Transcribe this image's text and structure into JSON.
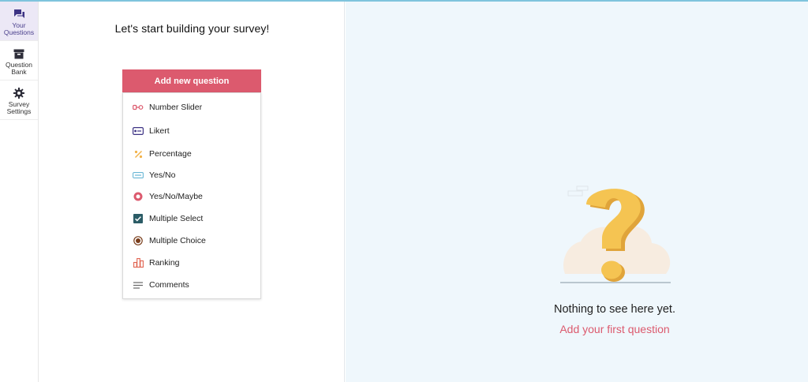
{
  "sidebar": {
    "items": [
      {
        "label": "Your Questions",
        "icon": "chat-bubbles-icon",
        "active": true
      },
      {
        "label": "Question Bank",
        "icon": "archive-box-icon",
        "active": false
      },
      {
        "label": "Survey Settings",
        "icon": "gear-icon",
        "active": false
      }
    ]
  },
  "builder": {
    "title": "Let's start building your survey!",
    "add_button": "Add new question",
    "question_types": [
      {
        "label": "Number Slider",
        "icon": "slider-icon"
      },
      {
        "label": "Likert",
        "icon": "likert-scale-icon"
      },
      {
        "label": "Percentage",
        "icon": "percent-icon"
      },
      {
        "label": "Yes/No",
        "icon": "toggle-bar-icon"
      },
      {
        "label": "Yes/No/Maybe",
        "icon": "radio-ring-icon"
      },
      {
        "label": "Multiple Select",
        "icon": "checkbox-checked-icon"
      },
      {
        "label": "Multiple Choice",
        "icon": "radio-dot-icon"
      },
      {
        "label": "Ranking",
        "icon": "bar-ranking-icon"
      },
      {
        "label": "Comments",
        "icon": "text-lines-icon"
      }
    ]
  },
  "empty_state": {
    "title": "Nothing to see here yet.",
    "link": "Add your first question",
    "illustration": "question-mark-illustration"
  },
  "colors": {
    "accent": "#dc5a6e",
    "active_nav": "#ece8f6",
    "nav_icon": "#4a3f8c",
    "empty_bg": "#eff7fc",
    "question_mark": "#f2c14e"
  }
}
